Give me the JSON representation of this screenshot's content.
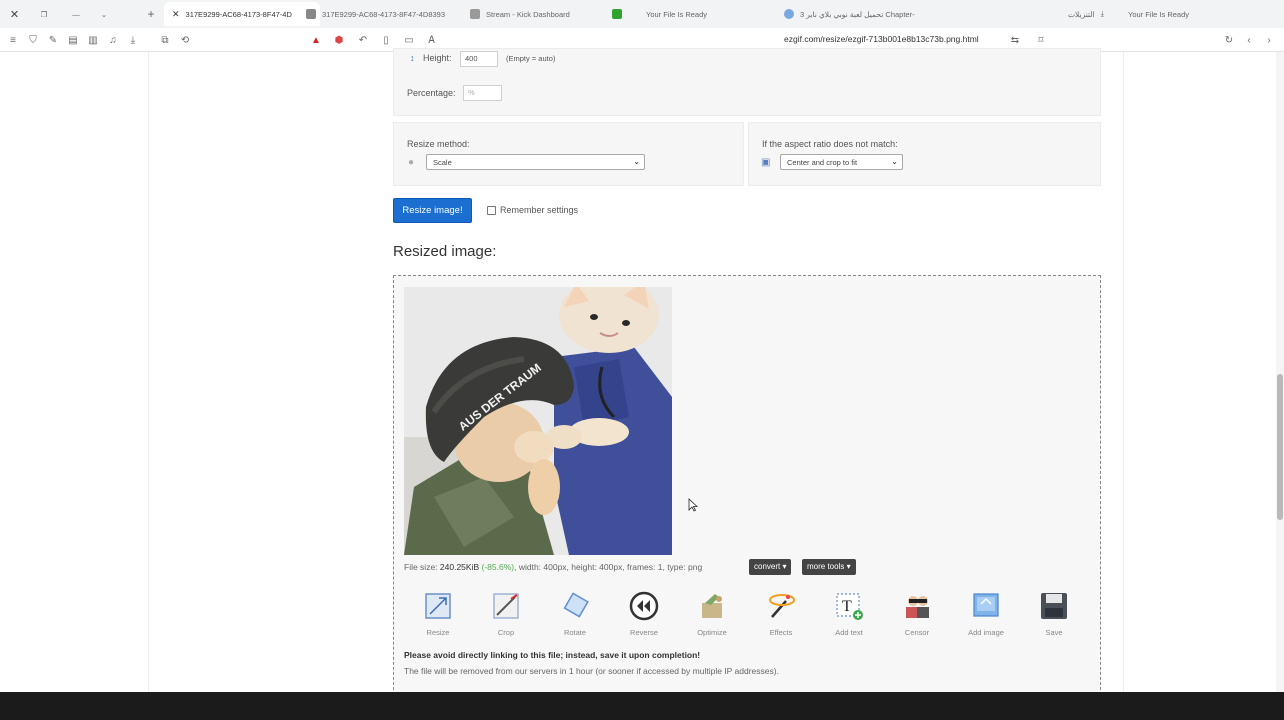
{
  "browser": {
    "tabs": [
      {
        "title": "317E9299-AC68-4173-8F47-4D",
        "active": true
      },
      {
        "title": "317E9299-AC68-4173-8F47-4D8393",
        "active": false
      },
      {
        "title": "Stream - Kick Dashboard",
        "active": false
      },
      {
        "title": "Your File Is Ready",
        "active": false
      },
      {
        "title": "تحميل لعبة نوبي بلاي ناير 3 Chapter-",
        "active": false
      },
      {
        "title": "التنزيلات",
        "active": false
      },
      {
        "title": "Your File Is Ready",
        "active": false
      }
    ],
    "url": "ezgif.com/resize/ezgif-713b001e8b13c73b.png.html"
  },
  "form": {
    "height_label": "Height:",
    "height_value": "400",
    "height_hint": "(Empty = auto)",
    "percentage_label": "Percentage:",
    "percentage_value": "% ",
    "resize_method_label": "Resize method:",
    "resize_method_value": "Scale",
    "aspect_label": "If the aspect ratio does not match:",
    "aspect_value": "Center and crop to fit",
    "resize_button": "Resize image!",
    "remember_label": "Remember settings"
  },
  "result": {
    "heading": "Resized image:",
    "helmet_text": "AUS DER TRAUM",
    "file_size_prefix": "File size: ",
    "file_size": "240.25KiB",
    "size_change": "(-85.6%)",
    "file_details": ", width: 400px, height: 400px, frames: 1, type: png",
    "convert_button": "convert ▾",
    "more_tools_button": "more tools ▾",
    "tools": [
      {
        "label": "Resize",
        "icon": "resize-icon"
      },
      {
        "label": "Crop",
        "icon": "crop-icon"
      },
      {
        "label": "Rotate",
        "icon": "rotate-icon"
      },
      {
        "label": "Reverse",
        "icon": "reverse-icon"
      },
      {
        "label": "Optimize",
        "icon": "optimize-icon"
      },
      {
        "label": "Effects",
        "icon": "effects-icon"
      },
      {
        "label": "Add text",
        "icon": "add-text-icon"
      },
      {
        "label": "Censor",
        "icon": "censor-icon"
      },
      {
        "label": "Add image",
        "icon": "add-image-icon"
      },
      {
        "label": "Save",
        "icon": "save-icon"
      }
    ],
    "note_bold": "Please avoid directly linking to this file; instead, save it upon completion!",
    "note_text": "The file will be removed from our servers in 1 hour (or sooner if accessed by multiple IP addresses)."
  }
}
